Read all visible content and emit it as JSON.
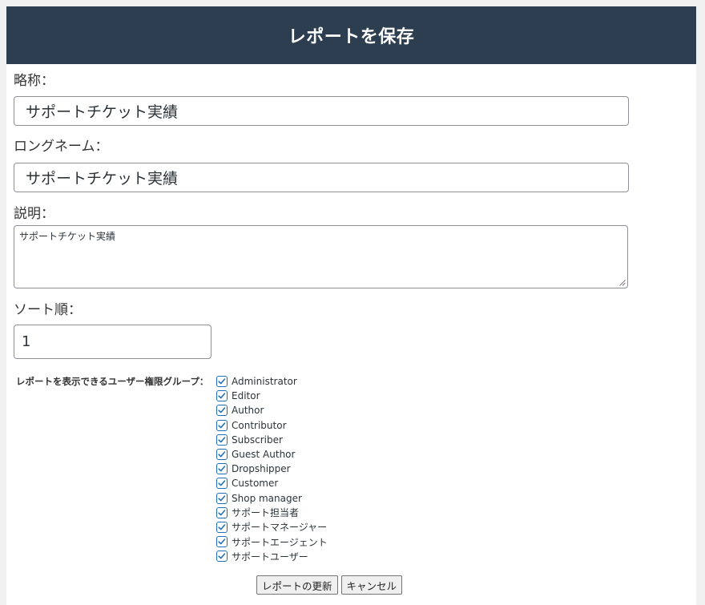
{
  "dialog": {
    "title": "レポートを保存"
  },
  "form": {
    "short_name": {
      "label": "略称：",
      "value": "サポートチケット実績"
    },
    "long_name": {
      "label": "ロングネーム：",
      "value": "サポートチケット実績"
    },
    "description": {
      "label": "説明：",
      "value": "サポートチケット実績"
    },
    "sort_order": {
      "label": "ソート順：",
      "value": "1"
    },
    "groups": {
      "label": "レポートを表示できるユーザー権限グループ：",
      "items": [
        {
          "label": "Administrator",
          "checked": true
        },
        {
          "label": "Editor",
          "checked": true
        },
        {
          "label": "Author",
          "checked": true
        },
        {
          "label": "Contributor",
          "checked": true
        },
        {
          "label": "Subscriber",
          "checked": true
        },
        {
          "label": "Guest Author",
          "checked": true
        },
        {
          "label": "Dropshipper",
          "checked": true
        },
        {
          "label": "Customer",
          "checked": true
        },
        {
          "label": "Shop manager",
          "checked": true
        },
        {
          "label": "サポート担当者",
          "checked": true
        },
        {
          "label": "サポートマネージャー",
          "checked": true
        },
        {
          "label": "サポートエージェント",
          "checked": true
        },
        {
          "label": "サポートユーザー",
          "checked": true
        }
      ]
    }
  },
  "buttons": {
    "update_label": "レポートの更新",
    "cancel_label": "キャンセル"
  },
  "colors": {
    "header_bg": "#2c3e50",
    "checkbox_accent": "#1e6fb8"
  }
}
